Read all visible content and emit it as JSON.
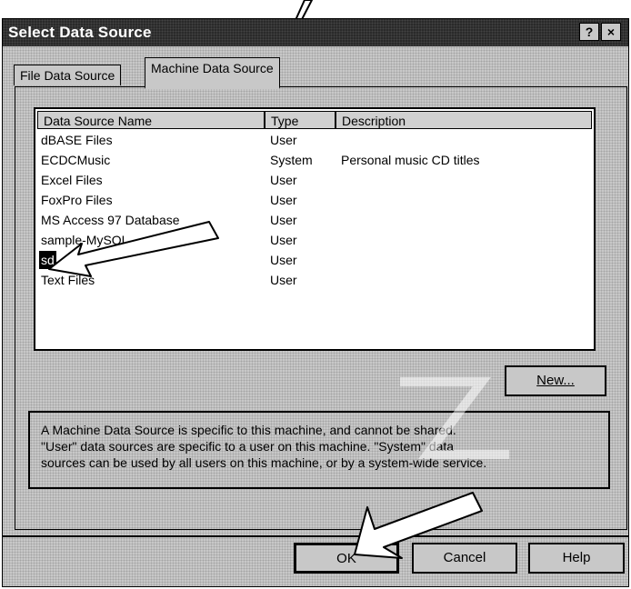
{
  "dialog": {
    "title": "Select Data Source",
    "help_button": "?",
    "close_button": "×"
  },
  "tabs": [
    {
      "label": "File Data Source"
    },
    {
      "label": "Machine Data Source"
    }
  ],
  "list": {
    "columns": [
      "Data Source Name",
      "Type",
      "Description"
    ],
    "rows": [
      {
        "name": "dBASE Files",
        "type": "User",
        "description": ""
      },
      {
        "name": "ECDCMusic",
        "type": "System",
        "description": "Personal music CD titles"
      },
      {
        "name": "Excel Files",
        "type": "User",
        "description": ""
      },
      {
        "name": "FoxPro Files",
        "type": "User",
        "description": ""
      },
      {
        "name": "MS Access 97 Database",
        "type": "User",
        "description": ""
      },
      {
        "name": "sample-MySQL",
        "type": "User",
        "description": ""
      },
      {
        "name": "sd",
        "type": "User",
        "description": ""
      },
      {
        "name": "Text Files",
        "type": "User",
        "description": ""
      }
    ],
    "selected_row": "sd"
  },
  "buttons": {
    "new": "New...",
    "ok": "OK",
    "cancel": "Cancel",
    "help": "Help"
  },
  "info": {
    "lines": [
      "A Machine Data Source is specific to this machine, and cannot be shared.",
      "\"User\" data sources are specific to a user on this machine.  \"System\" data",
      "sources can be used by all users on this machine, or by a system-wide service."
    ]
  },
  "annotation_icons": [
    "arrow-icon-tab",
    "arrow-icon-sd",
    "arrow-icon-ok"
  ]
}
